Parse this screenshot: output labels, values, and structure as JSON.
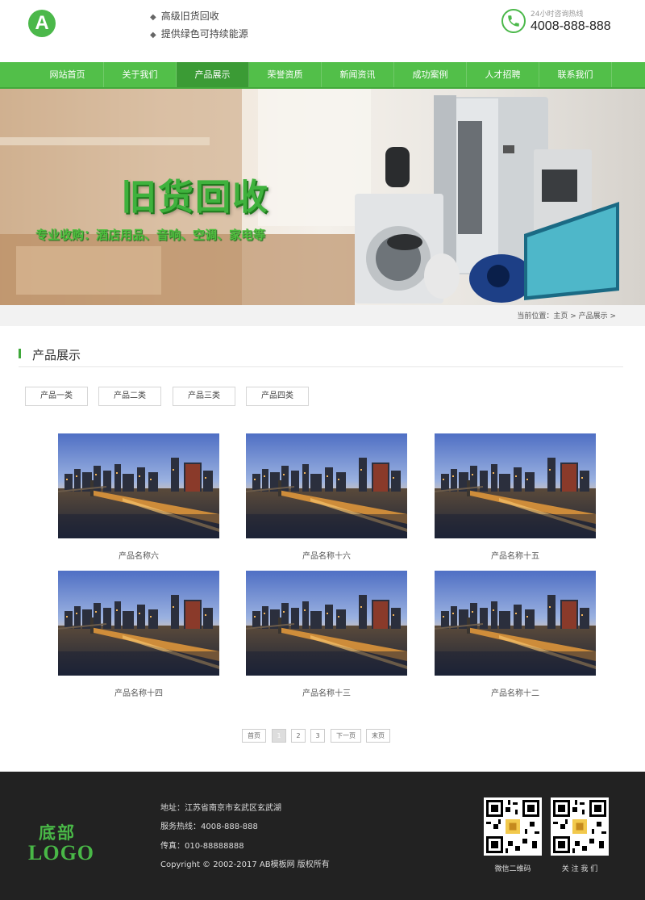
{
  "header": {
    "logo_letter": "A",
    "slogans": [
      "高级旧货回收",
      "提供绿色可持续能源"
    ],
    "hotline_label": "24小时咨询热线",
    "hotline_number": "4008-888-888"
  },
  "nav": [
    "网站首页",
    "关于我们",
    "产品展示",
    "荣誉资质",
    "新闻资讯",
    "成功案例",
    "人才招聘",
    "联系我们"
  ],
  "banner": {
    "title": "旧货回收",
    "subtitle": "专业收购：酒店用品、音响、空调、家电等"
  },
  "breadcrumb": "当前位置：主页 > 产品展示 >",
  "section_title": "产品展示",
  "categories": [
    "产品一类",
    "产品二类",
    "产品三类",
    "产品四类"
  ],
  "products": [
    "产品名称六",
    "产品名称十六",
    "产品名称十五",
    "产品名称十四",
    "产品名称十三",
    "产品名称十二"
  ],
  "pagination": [
    "首页",
    "1",
    "2",
    "3",
    "下一页",
    "末页"
  ],
  "footer": {
    "logo_line1": "底部",
    "logo_line2": "LOGO",
    "address": "地址：江苏省南京市玄武区玄武湖",
    "service": "服务热线：4008-888-888",
    "fax": "传真：010-88888888",
    "copyright": "Copyright © 2002-2017 AB模板网 版权所有",
    "qr1_label": "微信二维码",
    "qr2_label": "关 注 我 们"
  },
  "colors": {
    "brand_green": "#52bf49",
    "nav_active": "#3b9b35",
    "footer_bg": "#222222"
  }
}
